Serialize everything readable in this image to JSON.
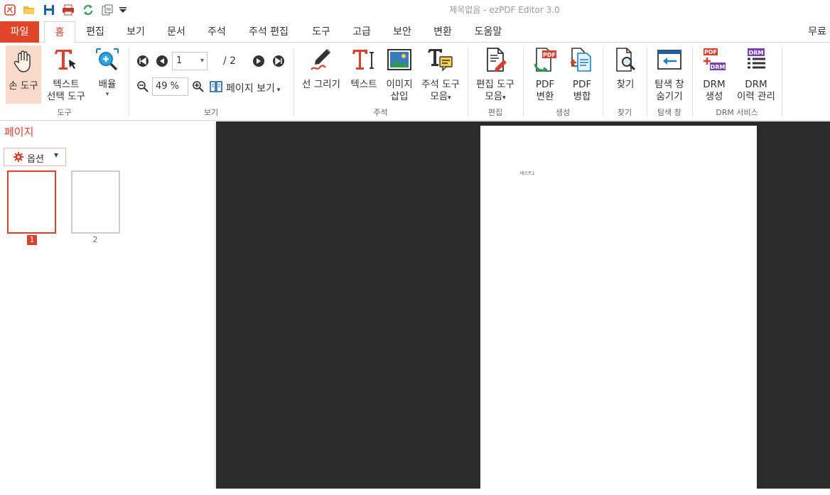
{
  "window": {
    "title": "제목없음 - ezPDF Editor 3.0"
  },
  "quick_access": [
    "app-logo-icon",
    "open-folder-icon",
    "save-icon",
    "print-icon",
    "refresh-icon",
    "page-copy-icon",
    "dropdown-arrow-icon"
  ],
  "tabs": {
    "file": "파일",
    "items": [
      "홈",
      "편집",
      "보기",
      "문서",
      "주석",
      "주석 편집",
      "도구",
      "고급",
      "보안",
      "변환",
      "도움말"
    ],
    "right": "무료"
  },
  "ribbon": {
    "tools": {
      "group": "도구",
      "hand_l1": "손 도구",
      "text_l1": "텍스트",
      "text_l2": "선택 도구",
      "zoom_l1": "배율"
    },
    "view": {
      "group": "보기",
      "page_value": "1",
      "page_total": "/ 2",
      "zoom_value": "49 %",
      "page_view": "페이지 보기"
    },
    "annotation": {
      "group": "주석",
      "draw": "선 그리기",
      "text": "텍스트",
      "image_l1": "이미지",
      "image_l2": "삽입",
      "tools_l1": "주석 도구",
      "tools_l2": "모음"
    },
    "edit": {
      "group": "편집",
      "tools_l1": "편집 도구",
      "tools_l2": "모음"
    },
    "create": {
      "group": "생성",
      "convert_l1": "PDF",
      "convert_l2": "변환",
      "merge_l1": "PDF",
      "merge_l2": "병합"
    },
    "find": {
      "group": "찾기",
      "label": "찾기"
    },
    "explorer": {
      "group": "탐색 창",
      "l1": "탐색 창",
      "l2": "숨기기"
    },
    "drm": {
      "group": "DRM 서비스",
      "create_l1": "DRM",
      "create_l2": "생성",
      "history_l1": "DRM",
      "history_l2": "이력 관리"
    }
  },
  "sidebar": {
    "title": "페이지",
    "options": "옵션",
    "thumbs": [
      "1",
      "2"
    ]
  },
  "document": {
    "text": "테스트1"
  },
  "colors": {
    "accent": "#d9412d",
    "file_tab": "#e0452a",
    "doc_bg": "#2b2b2b"
  }
}
